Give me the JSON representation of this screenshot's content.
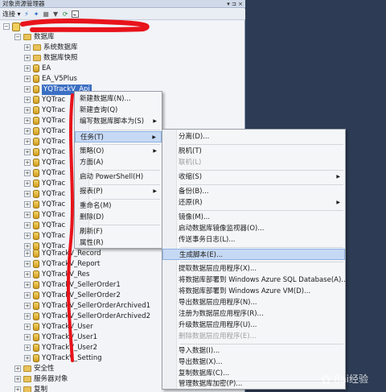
{
  "window": {
    "title": "对象资源管理器",
    "pin_glyphs": "▾ ⊐ ×"
  },
  "toolbar": {
    "connect_label": "连接 ▾"
  },
  "tree": {
    "server_label": "",
    "databases_label": "数据库",
    "system_db_label": "系统数据库",
    "snapshots_label": "数据库快照",
    "db_ea": "EA",
    "db_ea_v5": "EA_V5Plus",
    "selected_db": "YQTrackV_Api",
    "truncated_prefix": "YQTrac",
    "full_items": [
      "YQTrackV_Record",
      "YQTrackV_Report",
      "YQTrackV_Res",
      "YQTrackV_SellerOrder1",
      "YQTrackV_SellerOrder2",
      "YQTrackV_SellerOrderArchived1",
      "YQTrackV_SellerOrderArchived2",
      "YQTrackV_User",
      "YQTrackV_User1",
      "YQTrackV_User2",
      "YQTrackV_Setting"
    ],
    "security_label": "安全性",
    "server_objects_label": "服务器对象",
    "replication_label": "复制"
  },
  "context_menu": {
    "new_db": "新建数据库(N)...",
    "new_query": "新建查询(Q)",
    "script_db": "编写数据库脚本为(S)",
    "tasks": "任务(T)",
    "policies": "策略(O)",
    "facets": "方面(A)",
    "powershell": "启动 PowerShell(H)",
    "reports": "报表(P)",
    "rename": "重命名(M)",
    "delete": "删除(D)",
    "refresh": "刷新(F)",
    "properties": "属性(R)"
  },
  "tasks_menu": {
    "detach": "分离(D)...",
    "take_offline": "脱机(T)",
    "bring_online": "联机(L)",
    "shrink": "收缩(S)",
    "backup": "备份(B)...",
    "restore": "还原(R)",
    "mirror": "镜像(M)...",
    "mirror_monitor": "启动数据库镜像监视器(O)...",
    "ship_logs": "传送事务日志(L)...",
    "generate_scripts": "生成脚本(E)...",
    "extract_dac": "提取数据层应用程序(X)...",
    "deploy_azure_sql": "将数据库部署到 Windows Azure SQL Database(A)...",
    "deploy_azure_vm": "将数据库部署到 Windows Azure VM(D)...",
    "export_dac": "导出数据层应用程序(N)...",
    "register_dac": "注册为数据层应用程序(R)...",
    "upgrade_dac": "升级数据层应用程序(U)...",
    "delete_dac": "删除数据层应用程序(E)...",
    "import_data": "导入数据(I)...",
    "export_data": "导出数据(X)...",
    "copy_db": "复制数据库(C)...",
    "manage_encryption": "管理数据库加密(P)..."
  },
  "watermark": {
    "text": "Bai经验"
  },
  "colors": {
    "selection": "#3b6fc4",
    "menu_highlight": "#c6d9f4",
    "annotation": "#e8131b",
    "background": "#2d3c54"
  }
}
